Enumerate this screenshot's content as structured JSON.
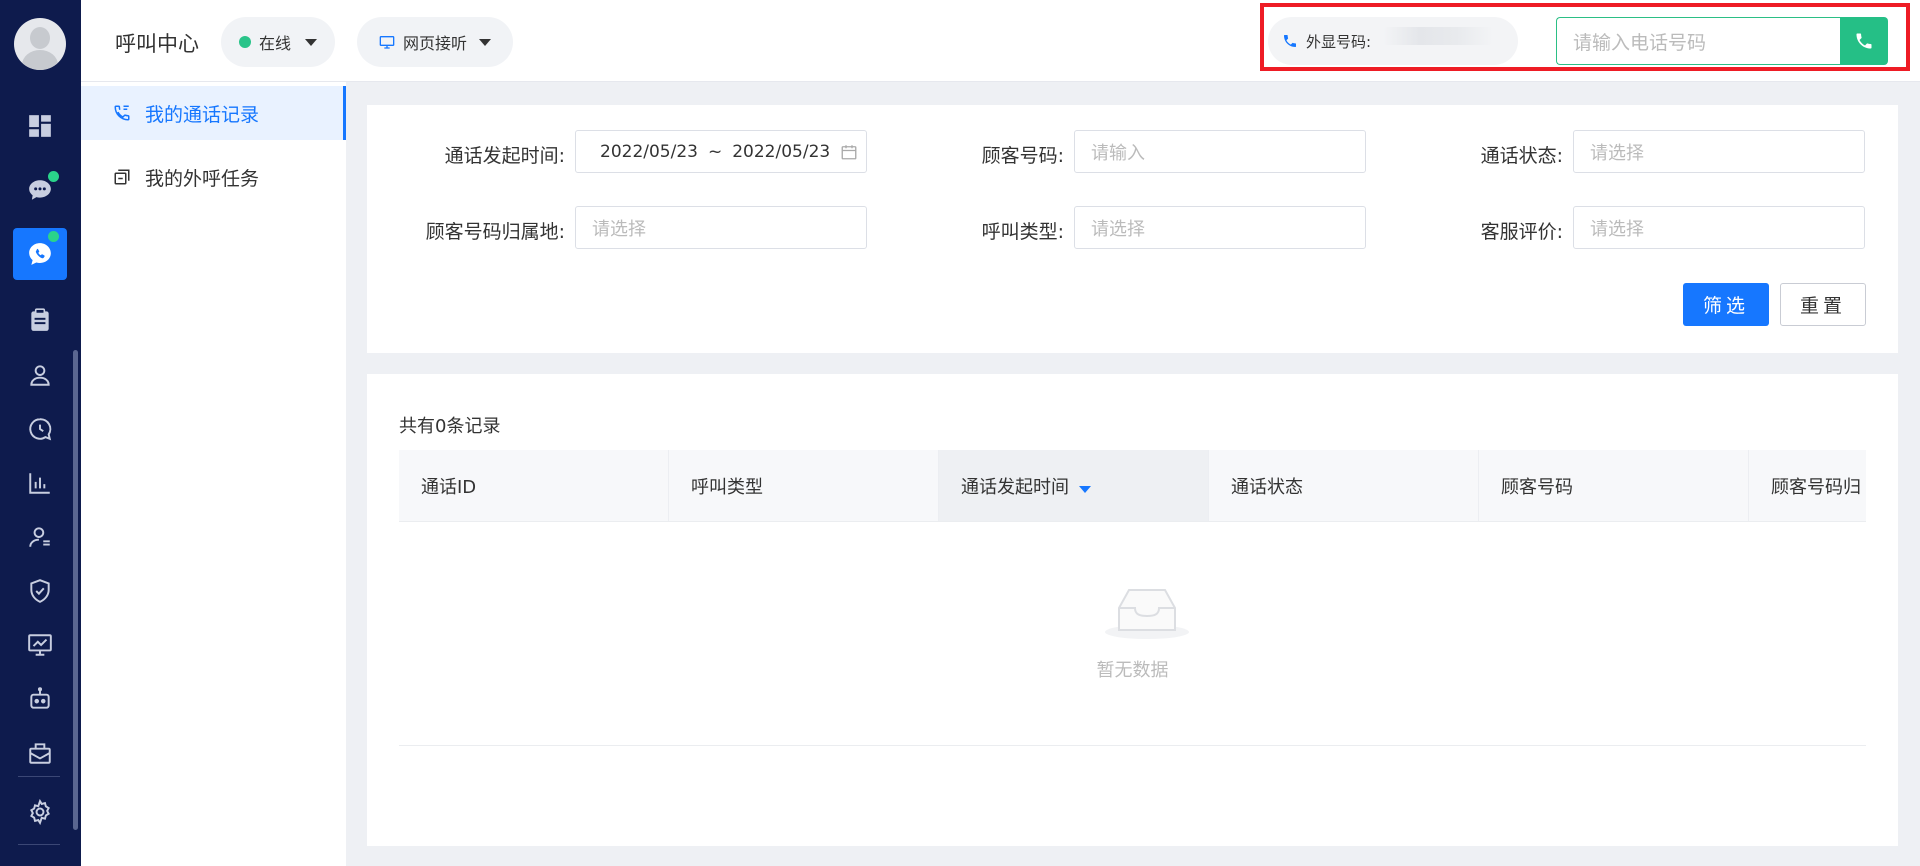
{
  "header": {
    "title": "呼叫中心",
    "status_label": "在线",
    "mode_label": "网页接听",
    "caller_label": "外显号码:",
    "dial_placeholder": "请输入电话号码"
  },
  "subnav": {
    "items": [
      {
        "label": "我的通话记录",
        "active": true
      },
      {
        "label": "我的外呼任务",
        "active": false
      }
    ]
  },
  "filters": {
    "call_time_label": "通话发起时间:",
    "date_start": "2022/05/23",
    "date_sep": "~",
    "date_end": "2022/05/23",
    "customer_number_label": "顾客号码:",
    "customer_number_placeholder": "请输入",
    "call_status_label": "通话状态:",
    "call_status_placeholder": "请选择",
    "region_label": "顾客号码归属地:",
    "region_placeholder": "请选择",
    "call_type_label": "呼叫类型:",
    "call_type_placeholder": "请选择",
    "rating_label": "客服评价:",
    "rating_placeholder": "请选择",
    "filter_button": "筛选",
    "reset_button": "重置"
  },
  "records": {
    "count_text": "共有0条记录",
    "columns": [
      "通话ID",
      "呼叫类型",
      "通话发起时间",
      "通话状态",
      "顾客号码",
      "顾客号码归"
    ],
    "empty_text": "暂无数据"
  },
  "colors": {
    "sidebar": "#0e1b4d",
    "accent": "#1677ff",
    "online": "#2ac48a",
    "dial": "#25bf86",
    "highlight": "#ee1c25"
  }
}
